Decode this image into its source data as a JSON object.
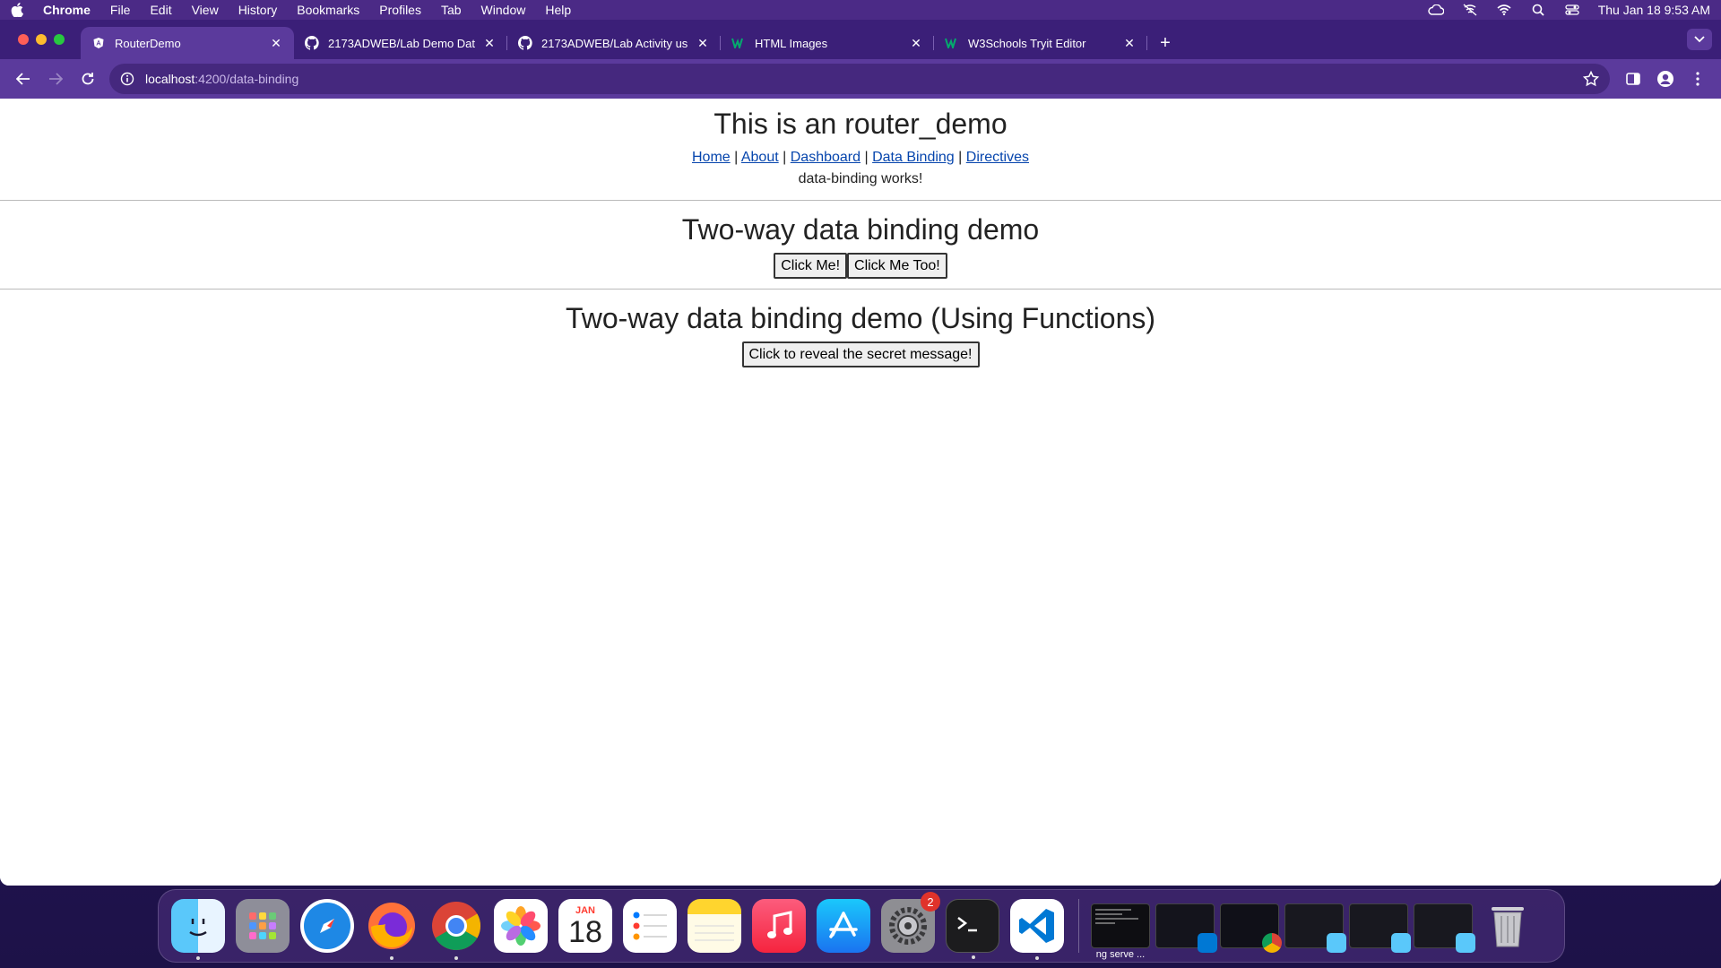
{
  "menubar": {
    "app": "Chrome",
    "items": [
      "File",
      "Edit",
      "View",
      "History",
      "Bookmarks",
      "Profiles",
      "Tab",
      "Window",
      "Help"
    ],
    "clock": "Thu Jan 18  9:53 AM"
  },
  "tabs": [
    {
      "title": "RouterDemo",
      "icon": "angular-icon"
    },
    {
      "title": "2173ADWEB/Lab Demo Data",
      "icon": "github-icon"
    },
    {
      "title": "2173ADWEB/Lab Activity usin",
      "icon": "github-icon"
    },
    {
      "title": "HTML Images",
      "icon": "w3schools-icon"
    },
    {
      "title": "W3Schools Tryit Editor",
      "icon": "w3schools-icon"
    }
  ],
  "omnibox": {
    "host": "localhost",
    "path": ":4200/data-binding"
  },
  "page": {
    "title": "This is an router_demo",
    "nav": [
      "Home",
      "About",
      "Dashboard",
      "Data Binding",
      "Directives"
    ],
    "nav_sep": "|",
    "status": "data-binding works!",
    "section1_title": "Two-way data binding demo",
    "btn_click_me": "Click Me!",
    "btn_click_me_too": "Click Me Too!",
    "section2_title": "Two-way data binding demo (Using Functions)",
    "btn_reveal": "Click to reveal the secret message!"
  },
  "dock": {
    "calendar_month": "JAN",
    "calendar_day": "18",
    "settings_badge": "2",
    "terminal_thumb_caption": "ng serve ..."
  },
  "colors": {
    "menubar": "#4b2a86",
    "tabstrip": "#3b1f78",
    "toolbar": "#5b3a9c",
    "link": "#0645ad"
  }
}
